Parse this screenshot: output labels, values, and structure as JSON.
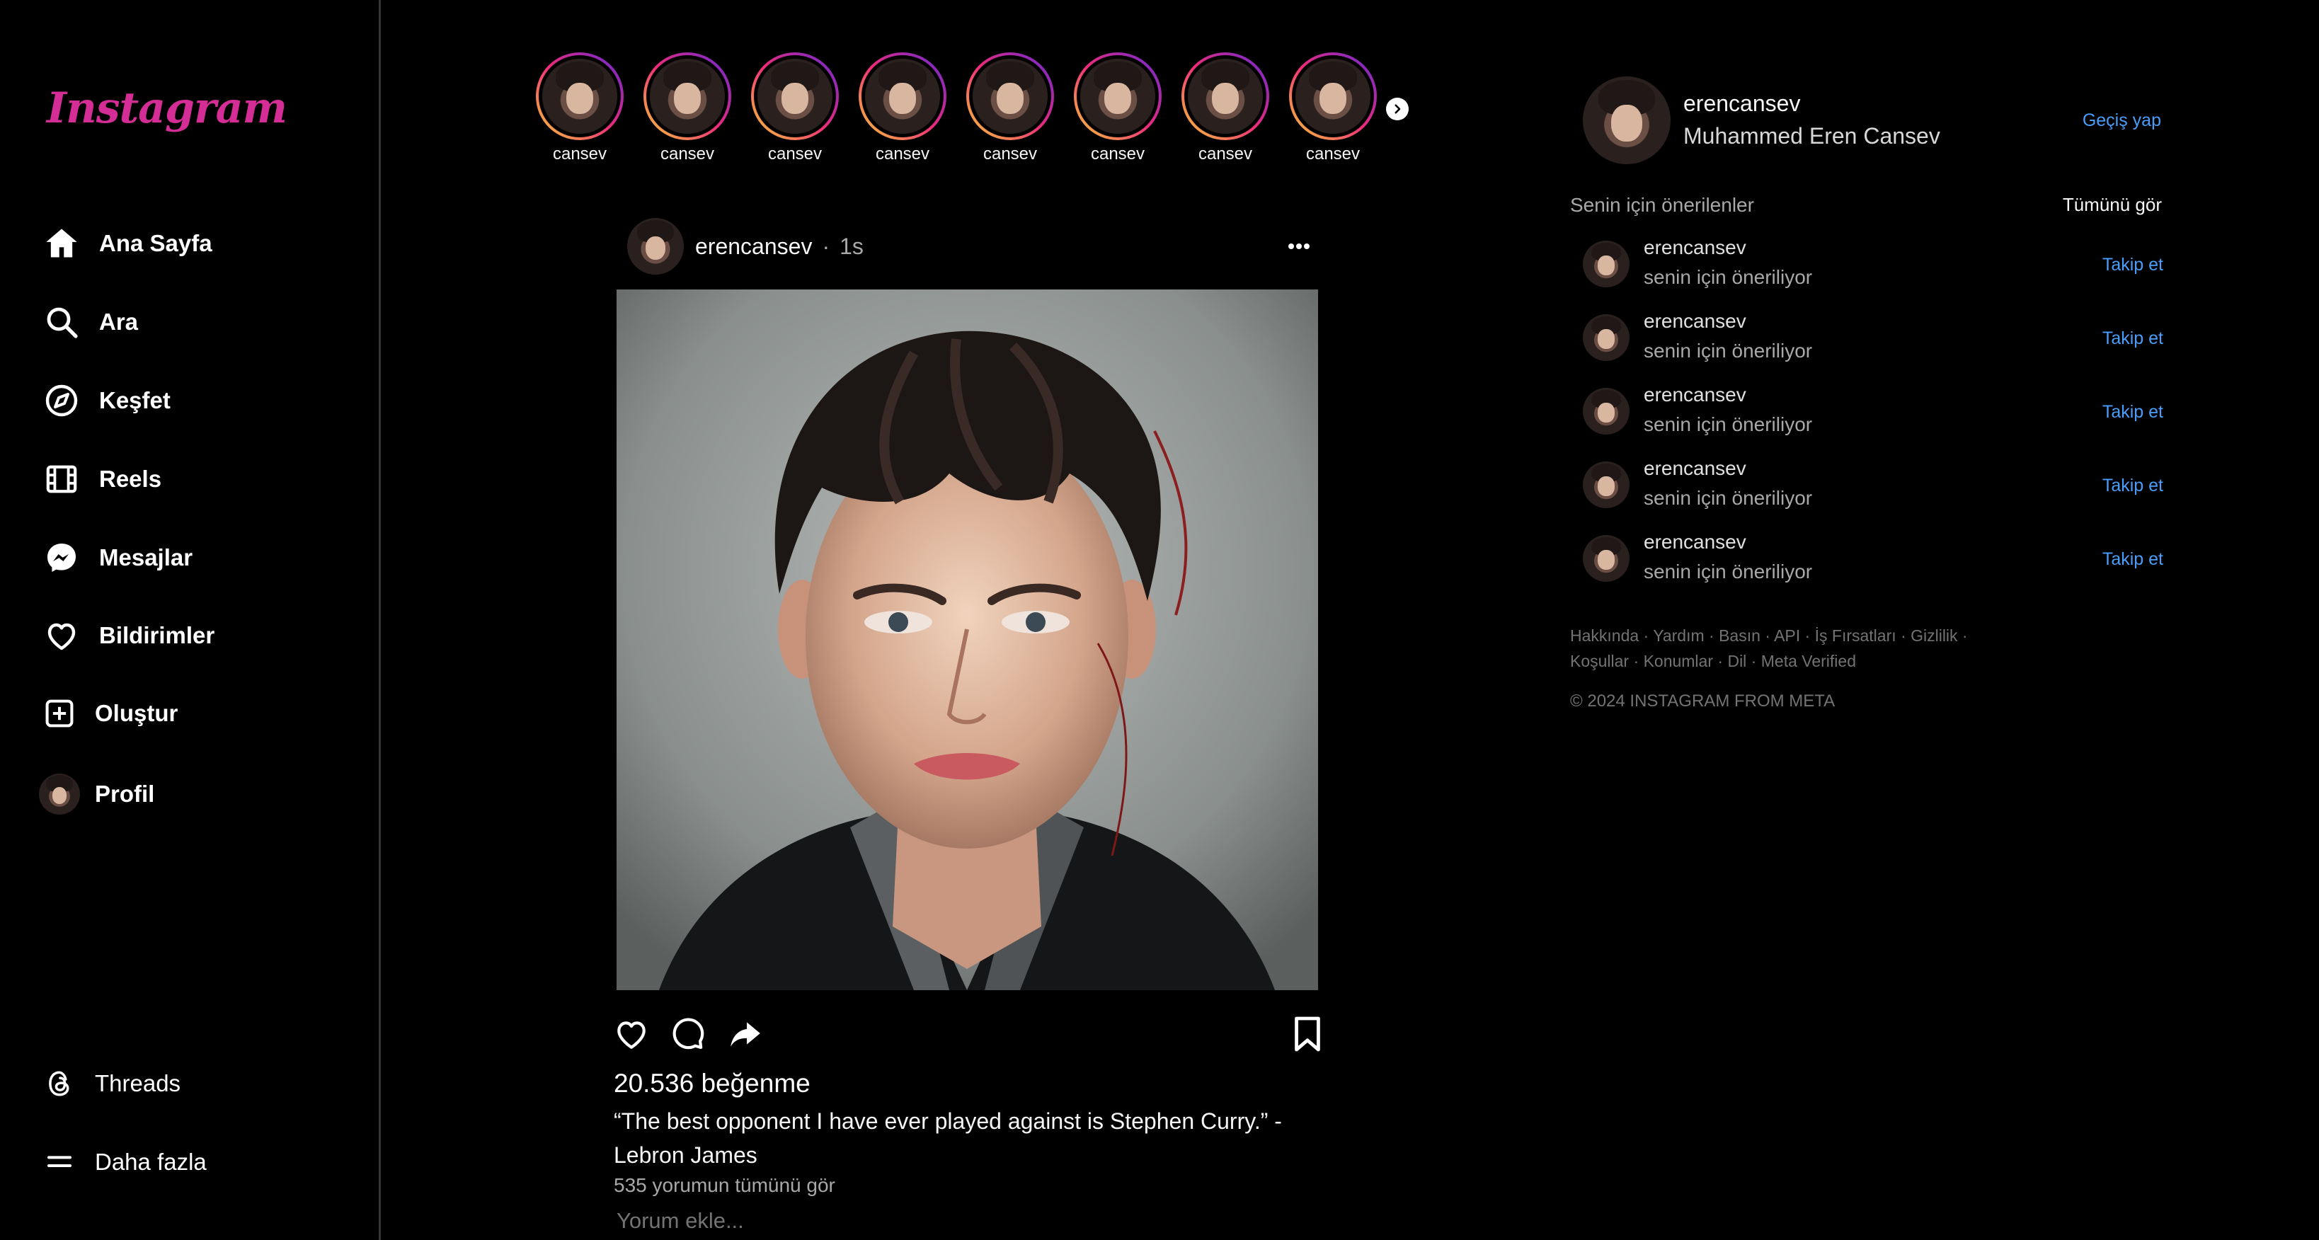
{
  "app": {
    "logo": "Instagram"
  },
  "sidebar": {
    "items": [
      {
        "label": "Ana Sayfa",
        "icon": "home-icon"
      },
      {
        "label": "Ara",
        "icon": "search-icon"
      },
      {
        "label": "Keşfet",
        "icon": "compass-icon"
      },
      {
        "label": "Reels",
        "icon": "reels-icon"
      },
      {
        "label": "Mesajlar",
        "icon": "messenger-icon"
      },
      {
        "label": "Bildirimler",
        "icon": "heart-icon"
      },
      {
        "label": "Oluştur",
        "icon": "plus-square-icon"
      },
      {
        "label": "Profil",
        "icon": "avatar"
      }
    ],
    "bottom": [
      {
        "label": "Threads",
        "icon": "threads-icon"
      },
      {
        "label": "Daha fazla",
        "icon": "menu-icon"
      }
    ]
  },
  "stories": [
    "cansev",
    "cansev",
    "cansev",
    "cansev",
    "cansev",
    "cansev",
    "cansev",
    "cansev"
  ],
  "post": {
    "username": "erencansev",
    "separator": "·",
    "time": "1s",
    "likes": "20.536 beğenme",
    "caption": "“The best opponent I have ever played against is Stephen Curry.” - Lebron James",
    "view_comments": "535 yorumun tümünü gör",
    "comment_placeholder": "Yorum ekle..."
  },
  "account": {
    "username": "erencansev",
    "fullname": "Muhammed Eren Cansev",
    "switch": "Geçiş yap"
  },
  "suggestions": {
    "title": "Senin için önerilenler",
    "see_all": "Tümünü gör",
    "items": [
      {
        "username": "erencansev",
        "sub": "senin için öneriliyor",
        "action": "Takip et"
      },
      {
        "username": "erencansev",
        "sub": "senin için öneriliyor",
        "action": "Takip et"
      },
      {
        "username": "erencansev",
        "sub": "senin için öneriliyor",
        "action": "Takip et"
      },
      {
        "username": "erencansev",
        "sub": "senin için öneriliyor",
        "action": "Takip et"
      },
      {
        "username": "erencansev",
        "sub": "senin için öneriliyor",
        "action": "Takip et"
      }
    ]
  },
  "footer": {
    "links": [
      "Hakkında",
      "Yardım",
      "Basın",
      "API",
      "İş Fırsatları",
      "Gizlilik",
      "Koşullar",
      "Konumlar",
      "Dil",
      "Meta Verified"
    ],
    "copyright": "© 2024 INSTAGRAM FROM META"
  },
  "colors": {
    "accent": "#4a9df8",
    "logo": "#d42d96",
    "background": "#000000"
  }
}
